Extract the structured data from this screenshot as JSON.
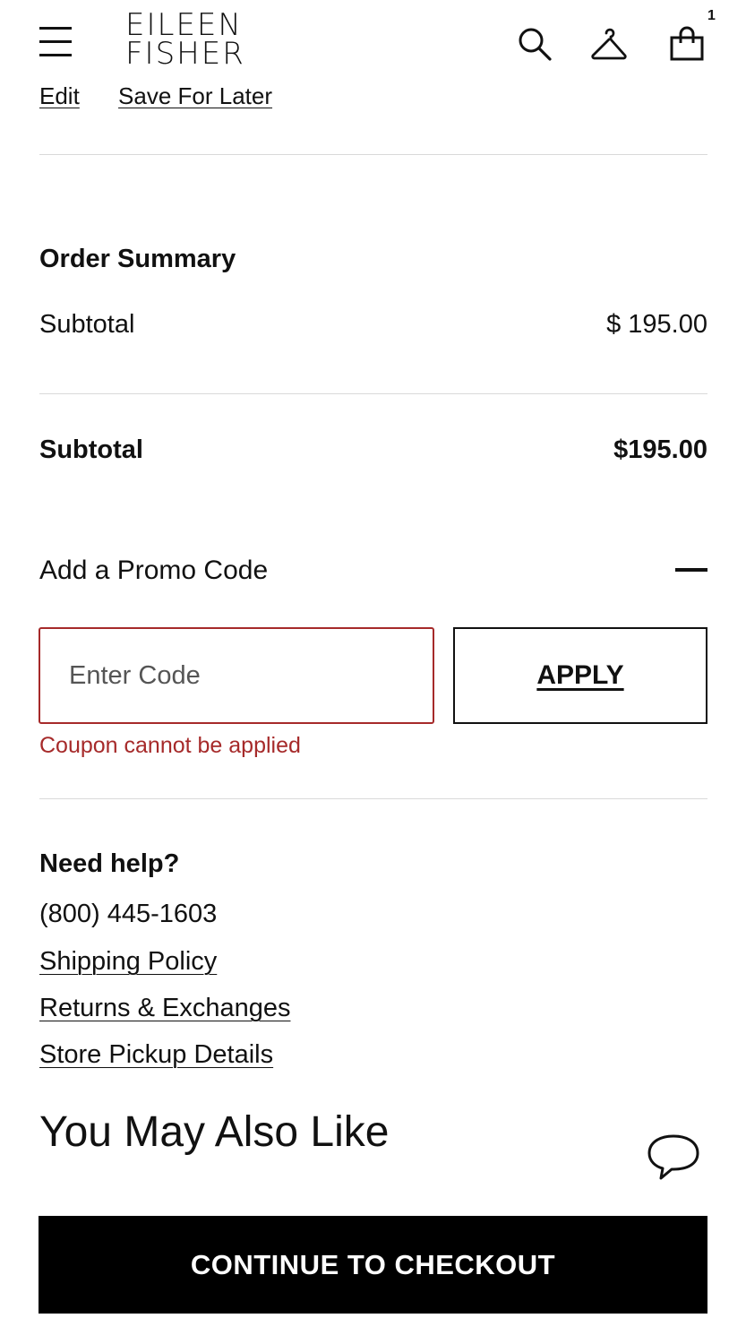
{
  "header": {
    "logo_line1": "EILEEN",
    "logo_line2": "FISHER",
    "bag_count": "1",
    "icons": [
      "menu-icon",
      "search-icon",
      "hanger-icon",
      "shopping-bag-icon"
    ]
  },
  "item_actions": {
    "edit_label": "Edit",
    "save_for_later_label": "Save For Later"
  },
  "order_summary": {
    "title": "Order Summary",
    "subtotal_label": "Subtotal",
    "subtotal_value": "$ 195.00",
    "total_label": "Subtotal",
    "total_value": "$195.00"
  },
  "promo": {
    "title": "Add a Promo Code",
    "toggle_icon": "minus-icon",
    "input_placeholder": "Enter Code",
    "input_value": "",
    "apply_label": "APPLY",
    "error_message": "Coupon cannot be applied"
  },
  "help": {
    "title": "Need help?",
    "phone": "(800) 445-1603",
    "links": [
      "Shipping Policy",
      "Returns & Exchanges",
      "Store Pickup Details"
    ]
  },
  "recommendations": {
    "title": "You May Also Like"
  },
  "checkout": {
    "button_label": "CONTINUE TO CHECKOUT"
  },
  "colors": {
    "error": "#a62a2a",
    "primary_button": "#000000",
    "divider": "#d9d9d9"
  }
}
